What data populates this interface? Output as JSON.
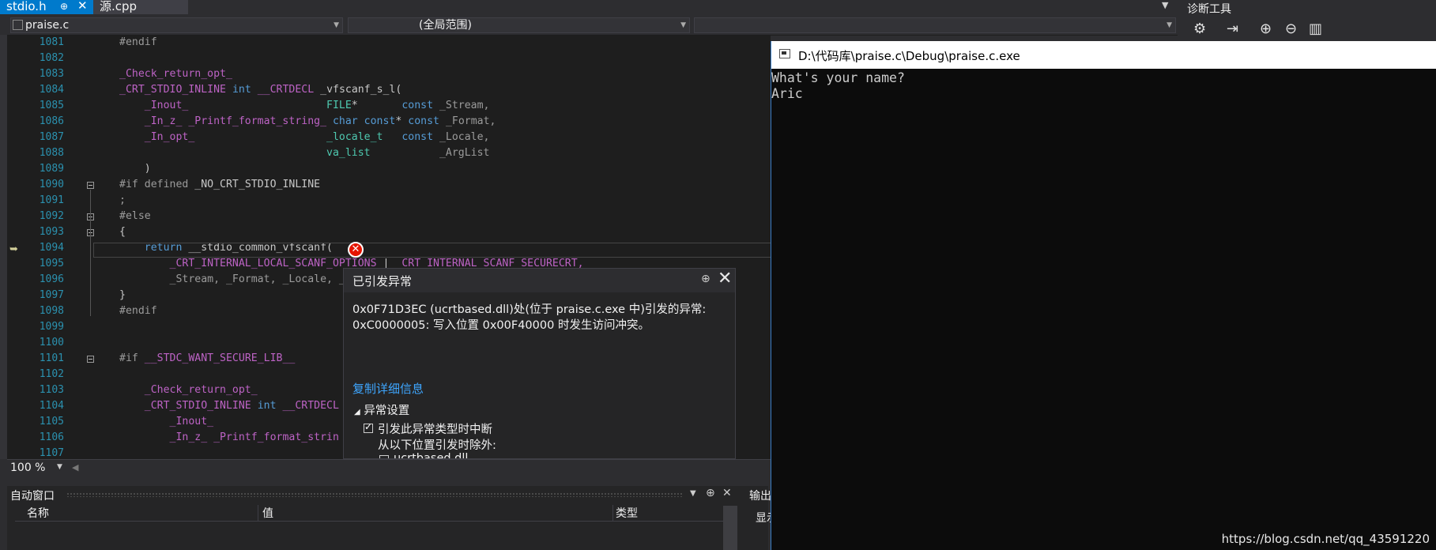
{
  "tabs": [
    {
      "label": "stdio.h",
      "pin": "⊕",
      "close": "✕"
    },
    {
      "label": "源.cpp"
    }
  ],
  "navbar": {
    "file": "praise.c",
    "scope": "(全局范围)"
  },
  "editor": {
    "lines": [
      {
        "n": "1081",
        "html": "<span class='pp'>#endif</span>"
      },
      {
        "n": "1082",
        "html": ""
      },
      {
        "n": "1083",
        "html": "<span class='mac'>_Check_return_opt_</span>"
      },
      {
        "n": "1084",
        "html": "<span class='mac'>_CRT_STDIO_INLINE</span> <span class='kw'>int</span> <span class='mac'>__CRTDECL</span> <span class='id'>_vfscanf_s_l(</span>"
      },
      {
        "n": "1085",
        "html": "    <span class='mac'>_Inout_</span>                      <span class='ty'>FILE</span><span class='id'>*</span>       <span class='kw'>const</span> <span class='gr'>_Stream,</span>"
      },
      {
        "n": "1086",
        "html": "    <span class='mac'>_In_z_ _Printf_format_string_</span> <span class='kw'>char const</span><span class='id'>*</span> <span class='kw'>const</span> <span class='gr'>_Format,</span>"
      },
      {
        "n": "1087",
        "html": "    <span class='mac'>_In_opt_</span>                     <span class='ty'>_locale_t</span>   <span class='kw'>const</span> <span class='gr'>_Locale,</span>"
      },
      {
        "n": "1088",
        "html": "                                 <span class='ty'>va_list</span>           <span class='gr'>_ArgList</span>"
      },
      {
        "n": "1089",
        "html": "    <span class='id'>)</span>"
      },
      {
        "n": "1090",
        "html": "<span class='pp'>#if defined</span> <span class='id'>_NO_CRT_STDIO_INLINE</span>"
      },
      {
        "n": "1091",
        "html": "<span class='gr'>;</span>"
      },
      {
        "n": "1092",
        "html": "<span class='pp'>#else</span>"
      },
      {
        "n": "1093",
        "html": "<span class='id'>{</span>"
      },
      {
        "n": "1094",
        "html": "    <span class='kw'>return</span> <span class='id'>__stdio_common_vfscanf(</span>"
      },
      {
        "n": "1095",
        "html": "        <span class='mac'>_CRT_INTERNAL_LOCAL_SCANF_OPTIONS</span> <span class='id'>|</span> <span class='mac'>_CRT_INTERNAL_SCANF_SECURECRT,</span>"
      },
      {
        "n": "1096",
        "html": "        <span class='gr'>_Stream, _Format, _Locale, _</span>"
      },
      {
        "n": "1097",
        "html": "<span class='id'>}</span>"
      },
      {
        "n": "1098",
        "html": "<span class='pp'>#endif</span>"
      },
      {
        "n": "1099",
        "html": ""
      },
      {
        "n": "1100",
        "html": ""
      },
      {
        "n": "1101",
        "html": "<span class='pp'>#if</span> <span class='mac'>__STDC_WANT_SECURE_LIB__</span>"
      },
      {
        "n": "1102",
        "html": ""
      },
      {
        "n": "1103",
        "html": "    <span class='mac'>_Check_return_opt_</span>"
      },
      {
        "n": "1104",
        "html": "    <span class='mac'>_CRT_STDIO_INLINE</span> <span class='kw'>int</span> <span class='mac'>__CRTDECL</span>"
      },
      {
        "n": "1105",
        "html": "        <span class='mac'>_Inout_</span>"
      },
      {
        "n": "1106",
        "html": "        <span class='mac'>_In_z_ _Printf_format_strin</span>"
      },
      {
        "n": "1107",
        "html": ""
      }
    ]
  },
  "zoom": {
    "value": "100 %"
  },
  "exception": {
    "title": "已引发异常",
    "message_line1": "0x0F71D3EC (ucrtbased.dll)处(位于 praise.c.exe 中)引发的异常:",
    "message_line2": "0xC0000005: 写入位置 0x00F40000 时发生访问冲突。",
    "copy_details": "复制详细信息",
    "settings_section": "异常设置",
    "break_when_thrown": "引发此异常类型时中断",
    "except_from": "从以下位置引发时除外:",
    "module": "ucrtbased.dll"
  },
  "auto_window": {
    "title": "自动窗口",
    "columns": [
      "名称",
      "值",
      "类型"
    ]
  },
  "output_panel": {
    "title": "输出",
    "show": "显示"
  },
  "diag_tool": {
    "title": "诊断工具"
  },
  "console": {
    "title": "D:\\代码库\\praise.c\\Debug\\praise.c.exe",
    "lines": [
      "What's your name?",
      "Aric"
    ]
  },
  "watermark": "https://blog.csdn.net/qq_43591220",
  "colors": {
    "accent": "#007acc",
    "error": "#e51400",
    "link": "#3ea6ff"
  }
}
